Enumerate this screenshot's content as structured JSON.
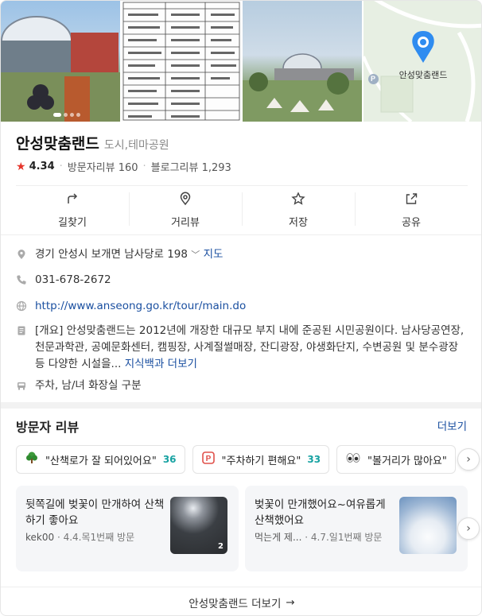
{
  "place": {
    "name": "안성맞춤랜드",
    "category": "도시,테마공원",
    "rating": "4.34",
    "visitor_reviews_label": "방문자리뷰 160",
    "blog_reviews_label": "블로그리뷰 1,293"
  },
  "actions": [
    {
      "label": "길찾기",
      "icon": "directions-icon"
    },
    {
      "label": "거리뷰",
      "icon": "street-view-icon"
    },
    {
      "label": "저장",
      "icon": "star-icon"
    },
    {
      "label": "공유",
      "icon": "share-icon"
    }
  ],
  "map": {
    "pin_label": "안성맞춤랜드",
    "parking_badge": "P"
  },
  "info": {
    "address": "경기 안성시 보개면 남사당로 198",
    "map_link": "지도",
    "phone": "031-678-2672",
    "website": "http://www.anseong.go.kr/tour/main.do",
    "description": "[개요] 안성맞춤랜드는 2012년에 개장한 대규모 부지 내에 준공된 시민공원이다. 남사당공연장, 천문과학관, 공예문화센터, 캠핑장, 사계절썰매장, 잔디광장, 야생화단지, 수변공원 및 분수광장 등 다양한 시설을...",
    "description_more": "지식백과 더보기",
    "amenities": "주차, 남/녀 화장실 구분"
  },
  "reviews_section": {
    "title": "방문자 리뷰",
    "more": "더보기",
    "chips": [
      {
        "icon": "tree-icon",
        "text": "\"산책로가 잘 되어있어요\"",
        "count": "36"
      },
      {
        "icon": "parking-icon",
        "text": "\"주차하기 편해요\"",
        "count": "33"
      },
      {
        "icon": "eyes-icon",
        "text": "\"볼거리가 많아요\"",
        "count": ""
      }
    ],
    "items": [
      {
        "text": "뒷쪽길에 벚꽃이 만개하여 산책하기 좋아요",
        "user": "kek00",
        "meta": "4.4.목1번째 방문",
        "photo_count": "2"
      },
      {
        "text": "벚꽃이 만개했어요~여유롭게 산책했어요",
        "user": "먹는게 제...",
        "meta": "4.7.일1번째 방문",
        "photo_count": ""
      }
    ]
  },
  "footer": {
    "label": "안성맞춤랜드 더보기",
    "arrow": "→"
  },
  "colors": {
    "accent_blue": "#1a4fa0",
    "star_red": "#e6352b",
    "count_teal": "#17a2a2"
  }
}
